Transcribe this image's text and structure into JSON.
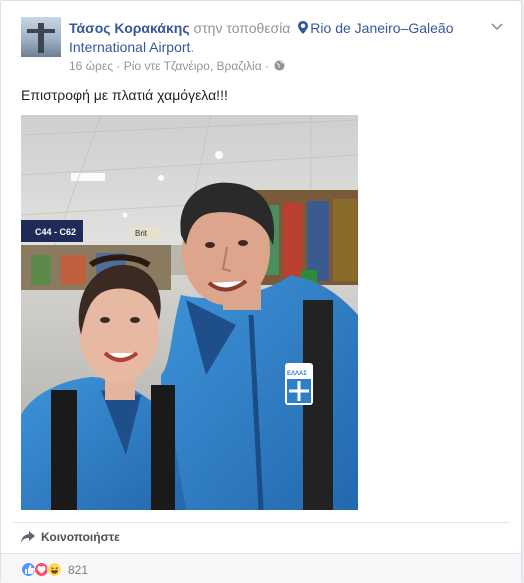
{
  "post": {
    "author": "Τάσος Κορακάκης",
    "at_label": "στην τοποθεσία",
    "place": "Rio de Janeiro–Galeão International Airport",
    "place_suffix": ".",
    "time": "16 ώρες",
    "separator": "·",
    "location": "Ρίο ντε Τζανέιρο, Βραζιλία",
    "text": "Επιστροφή με πλατιά χαμόγελα!!!",
    "share_label": "Κοινοποιήστε",
    "reaction_count": "821"
  },
  "photo_signs": {
    "gate_sign": "C44 - C62",
    "shop_sign": "Brit",
    "badge_text": "ΕΛΛΑΣ"
  },
  "icons": [
    "pin-icon",
    "globe-icon",
    "chevron-down-icon",
    "share-icon",
    "like-reaction-icon",
    "love-reaction-icon",
    "haha-reaction-icon"
  ],
  "colors": {
    "link": "#365899",
    "meta": "#90949c",
    "jacket": "#2f7fc8",
    "like": "#5890ff",
    "love": "#f25268",
    "haha": "#ffd95e"
  }
}
